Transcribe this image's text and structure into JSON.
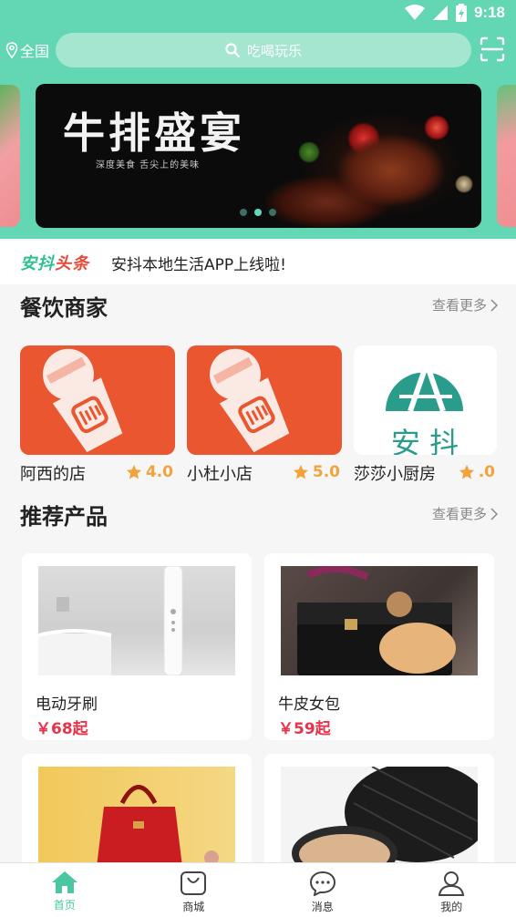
{
  "status": {
    "time": "9:18"
  },
  "header": {
    "location": "全国",
    "search_placeholder": "吃喝玩乐"
  },
  "banner": {
    "title": "牛排盛宴",
    "subtitle": "深度美食  舌尖上的美味"
  },
  "news": {
    "logo_a": "安抖",
    "logo_b": "头条",
    "text": "安抖本地生活APP上线啦!"
  },
  "restaurants": {
    "title": "餐饮商家",
    "more": "查看更多",
    "items": [
      {
        "name": "阿西的店",
        "rating": "4.0"
      },
      {
        "name": "小杜小店",
        "rating": "5.0"
      },
      {
        "name": "莎莎小厨房",
        "rating": ".0"
      }
    ],
    "logo_text": "安 抖"
  },
  "products": {
    "title": "推荐产品",
    "more": "查看更多",
    "items": [
      {
        "name": "电动牙刷",
        "price": "￥68起"
      },
      {
        "name": "牛皮女包",
        "price": "￥59起"
      },
      {
        "name": "",
        "price": ""
      },
      {
        "name": "",
        "price": ""
      }
    ]
  },
  "tabs": [
    {
      "label": "首页",
      "icon": "home-icon"
    },
    {
      "label": "商城",
      "icon": "shop-bag-icon"
    },
    {
      "label": "消息",
      "icon": "message-icon"
    },
    {
      "label": "我的",
      "icon": "profile-icon"
    }
  ],
  "colors": {
    "accent": "#63d6b3",
    "price": "#e8334a",
    "star": "#f3a33c"
  }
}
